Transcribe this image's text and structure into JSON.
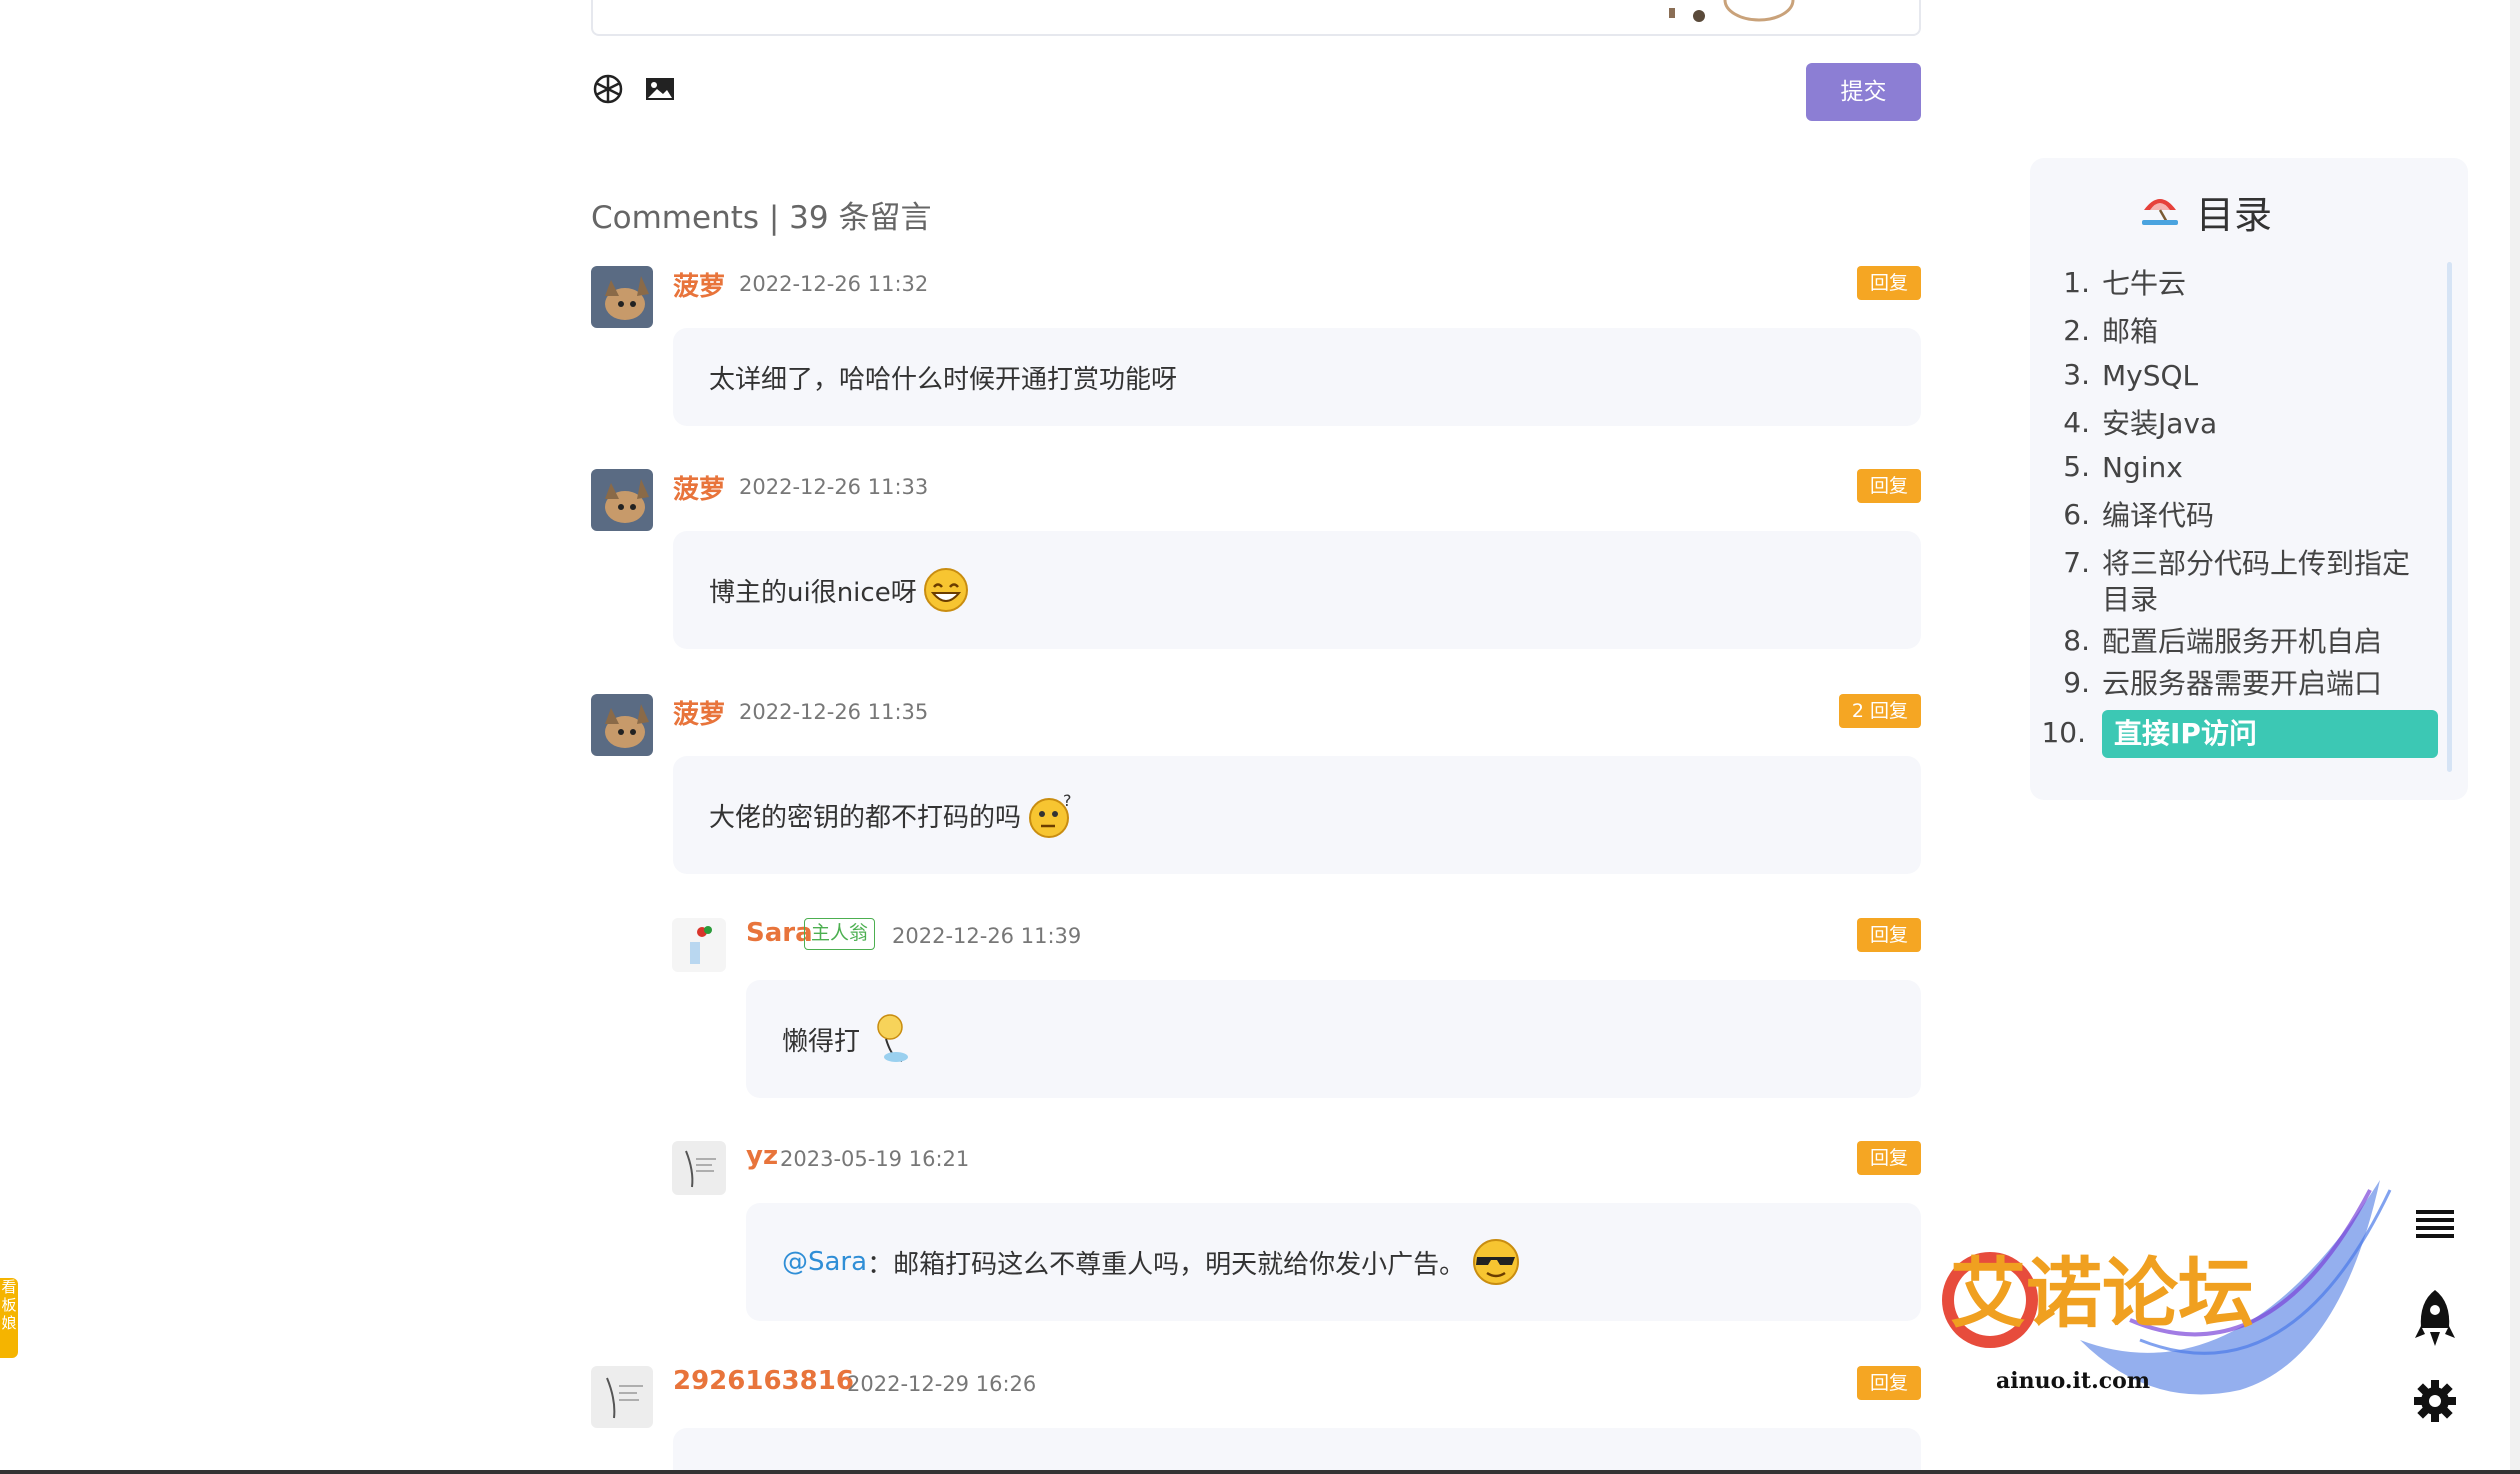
{
  "editor": {
    "submit_label": "提交"
  },
  "comments_header": {
    "title": "Comments | 39 条留言"
  },
  "comments": [
    {
      "name": "菠萝",
      "time": "2022-12-26 11:32",
      "reply": "回复",
      "text": "太详细了，哈哈什么时候开通打赏功能呀"
    },
    {
      "name": "菠萝",
      "time": "2022-12-26 11:33",
      "reply": "回复",
      "text": "博主的ui很nice呀"
    },
    {
      "name": "菠萝",
      "time": "2022-12-26 11:35",
      "reply": "2 回复",
      "text": "大佬的密钥的都不打码的吗"
    },
    {
      "name": "Sara",
      "tag": "主人翁",
      "time": "2022-12-26 11:39",
      "reply": "回复",
      "text": "懒得打"
    },
    {
      "name": "yz",
      "time": "2023-05-19 16:21",
      "reply": "回复",
      "mention": "@Sara",
      "text": "：邮箱打码这么不尊重人吗，明天就给你发小广告。"
    },
    {
      "name": "2926163816",
      "time": "2022-12-29 16:26",
      "reply": "回复"
    }
  ],
  "toc": {
    "title": "目录",
    "items": [
      {
        "num": "1.",
        "label": "七牛云"
      },
      {
        "num": "2.",
        "label": "邮箱"
      },
      {
        "num": "3.",
        "label": "MySQL"
      },
      {
        "num": "4.",
        "label": "安装Java"
      },
      {
        "num": "5.",
        "label": "Nginx"
      },
      {
        "num": "6.",
        "label": "编译代码"
      },
      {
        "num": "7.",
        "label": "将三部分代码上传到指定目录"
      },
      {
        "num": "8.",
        "label": "配置后端服务开机自启"
      },
      {
        "num": "9.",
        "label": "云服务器需要开启端口"
      },
      {
        "num": "10.",
        "label": "直接IP访问",
        "active": true
      }
    ]
  },
  "side_tab": {
    "label": "看板娘"
  },
  "watermark": {
    "brand": "艾诺论坛",
    "url": "ainuo.it.com"
  },
  "colors": {
    "accent": "#8c7ed4",
    "name": "#e8743b",
    "reply": "#f5a623",
    "toc_active": "#3cc8b4",
    "link": "#2f8ed6"
  },
  "icons": [
    "emoji-icon",
    "image-icon",
    "menu-icon",
    "rocket-icon",
    "gear-icon"
  ]
}
